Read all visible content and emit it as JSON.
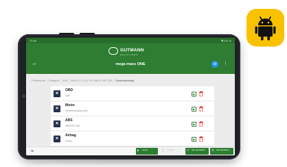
{
  "status_bar": {
    "time": "10:58",
    "right": "◥ 100 %"
  },
  "header": {
    "brand_name": "GUTMANN",
    "brand_sub": "SOLUTIONS",
    "title": "mega macs ONE",
    "user_initial": "U",
    "back_icon": "arrow-left-icon",
    "menu_icon": "more-vert-icon"
  },
  "breadcrumb": [
    "Fehlercode",
    "Peugeot",
    "308",
    "308-II 1.2i 12V VTi SM 6 THP 130",
    "Gesamtabfrage"
  ],
  "list": [
    {
      "title": "OBD",
      "subtitle": "OBD"
    },
    {
      "title": "Motor",
      "subtitle": "Steuereinrichtung OBD"
    },
    {
      "title": "ABS",
      "subtitle": "ABS/ESP OBD"
    },
    {
      "title": "Airbag",
      "subtitle": "Airbag"
    }
  ],
  "bottom_bar": {
    "check_label": "Lesen",
    "delete_label": "Löschen",
    "select_all_label": "Alle auswählen",
    "deselect_all_label": "Alle abwählen"
  },
  "colors": {
    "primary": "#2e7d32",
    "item_icon": "#22314d",
    "delete": "#e53935",
    "android_badge": "#f9c200",
    "android_robot": "#111111"
  }
}
